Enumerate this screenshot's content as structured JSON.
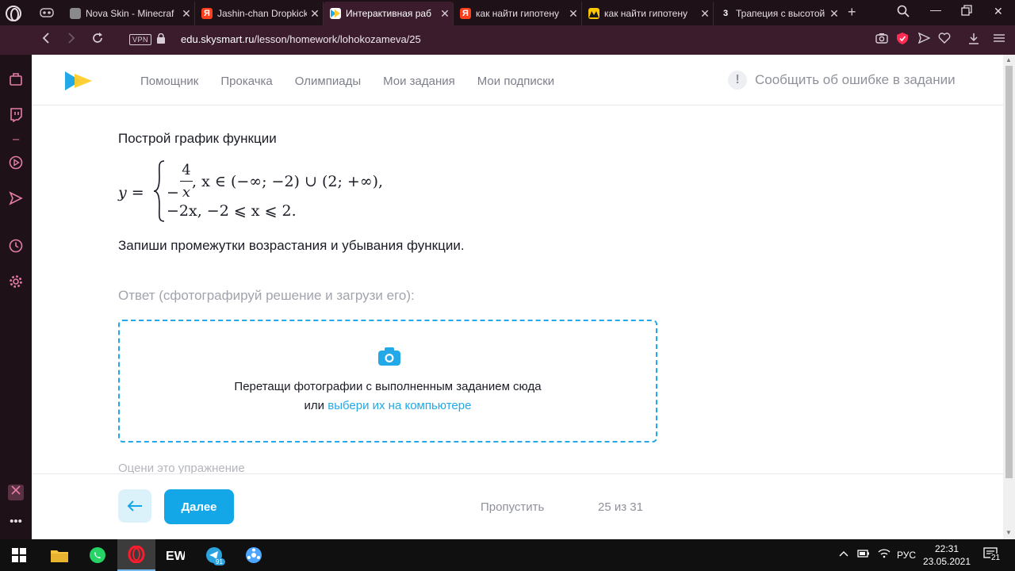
{
  "browser": {
    "tabs": [
      {
        "label": "Nova Skin - Minecraf",
        "favicon": "nova-skin-icon",
        "active": false
      },
      {
        "label": "Jashin-chan Dropkick",
        "favicon": "yandex-icon",
        "active": false
      },
      {
        "label": "Интерактивная раб",
        "favicon": "skysmart-icon",
        "active": true
      },
      {
        "label": "как найти гипотену",
        "favicon": "yandex-icon",
        "active": false
      },
      {
        "label": "как найти гипотену",
        "favicon": "znanija-icon",
        "active": false
      },
      {
        "label": "Трапеция с высотой",
        "favicon": "three-icon",
        "active": false
      }
    ],
    "vpn_label": "VPN",
    "url_host": "edu.skysmart.ru",
    "url_path": "/lesson/homework/lohokozameva/25"
  },
  "header": {
    "menu": [
      "Помощник",
      "Прокачка",
      "Олимпиады",
      "Мои задания",
      "Мои подписки"
    ],
    "report_label": "Сообщить об ошибке в задании"
  },
  "task": {
    "title": "Построй график функции",
    "formula": {
      "lhs": "y =",
      "case1_num": "4",
      "case1_den": "x",
      "case1_cond": ", x ∈ (−∞; −2) ∪ (2; +∞),",
      "case2": "−2x, −2 ⩽ x ⩽ 2."
    },
    "instruction": "Запиши промежутки возрастания и убывания функции."
  },
  "answer": {
    "label": "Ответ (сфотографируй решение и загрузи его):",
    "drop_text": "Перетащи фотографии с выполненным заданием сюда",
    "or_text": "или",
    "choose_link": "выбери их на компьютере"
  },
  "rate_label": "Оцени это упражнение",
  "footer": {
    "next_label": "Далее",
    "skip_label": "Пропустить",
    "counter": "25 из 31"
  },
  "taskbar": {
    "lang": "РУС",
    "time": "22:31",
    "date": "23.05.2021",
    "notifications": "21",
    "telegram_badge": "91"
  },
  "colors": {
    "accent": "#13a7e8",
    "browser_bg": "#3a1c2c",
    "sidebar_icon": "#e57da6"
  }
}
